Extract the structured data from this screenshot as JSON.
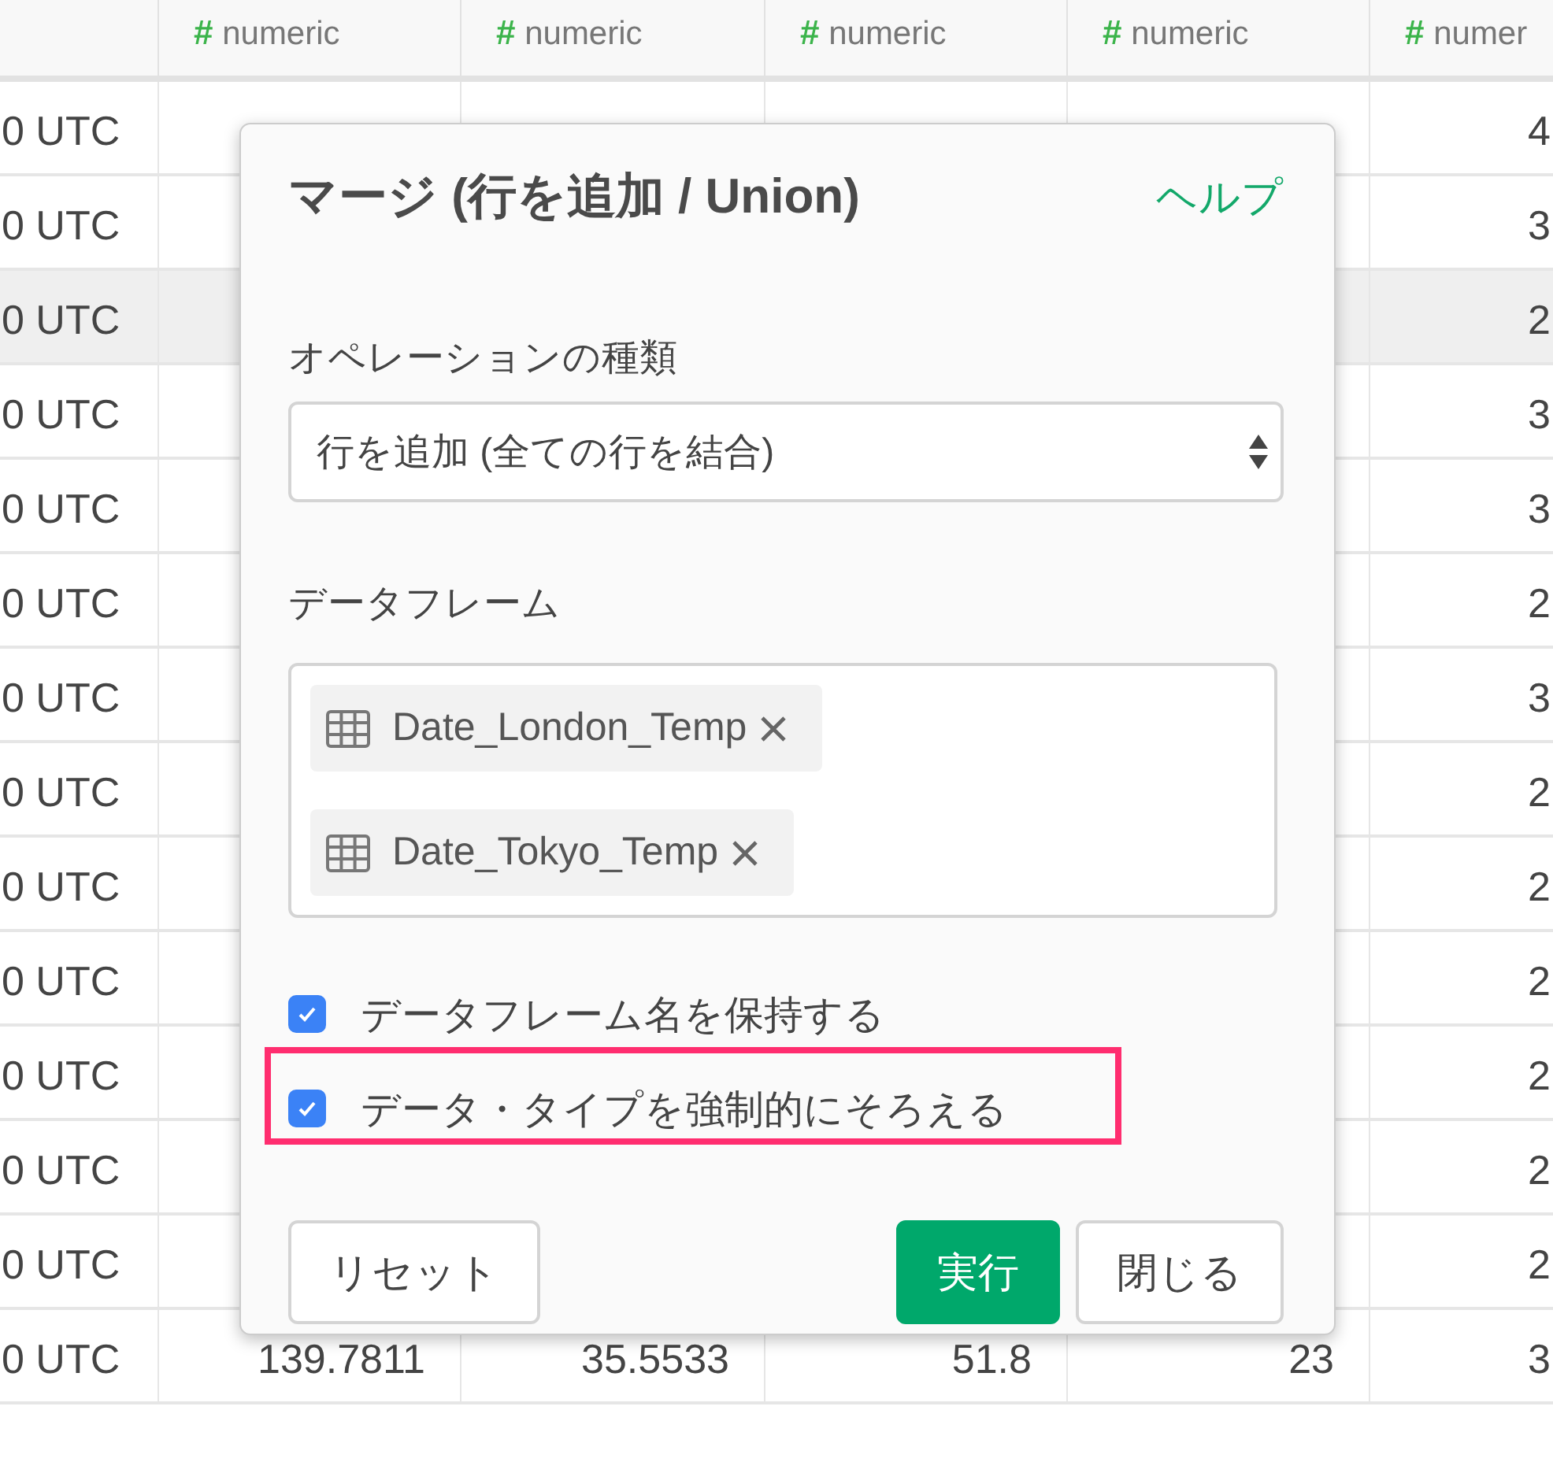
{
  "table": {
    "columns": [
      {
        "type_icon": "#",
        "label": "numeric"
      },
      {
        "type_icon": "#",
        "label": "numeric"
      },
      {
        "type_icon": "#",
        "label": "numeric"
      },
      {
        "type_icon": "#",
        "label": "numeric"
      },
      {
        "type_icon": "#",
        "label": "numer"
      }
    ],
    "rows": [
      {
        "highlighted": false,
        "cells": [
          "0 UTC",
          null,
          null,
          null,
          null,
          "4"
        ]
      },
      {
        "highlighted": false,
        "cells": [
          "0 UTC",
          null,
          null,
          null,
          null,
          "3"
        ]
      },
      {
        "highlighted": true,
        "cells": [
          "0 UTC",
          null,
          null,
          null,
          null,
          "2"
        ]
      },
      {
        "highlighted": false,
        "cells": [
          "0 UTC",
          null,
          null,
          null,
          null,
          "3"
        ]
      },
      {
        "highlighted": false,
        "cells": [
          "0 UTC",
          null,
          null,
          null,
          null,
          "3"
        ]
      },
      {
        "highlighted": false,
        "cells": [
          "0 UTC",
          null,
          null,
          null,
          null,
          "2"
        ]
      },
      {
        "highlighted": false,
        "cells": [
          "0 UTC",
          null,
          null,
          null,
          null,
          "3"
        ]
      },
      {
        "highlighted": false,
        "cells": [
          "0 UTC",
          null,
          null,
          null,
          null,
          "2"
        ]
      },
      {
        "highlighted": false,
        "cells": [
          "0 UTC",
          null,
          null,
          null,
          null,
          "2"
        ]
      },
      {
        "highlighted": false,
        "cells": [
          "0 UTC",
          null,
          null,
          null,
          null,
          "2"
        ]
      },
      {
        "highlighted": false,
        "cells": [
          "0 UTC",
          null,
          null,
          null,
          null,
          "2"
        ]
      },
      {
        "highlighted": false,
        "cells": [
          "0 UTC",
          null,
          null,
          null,
          null,
          "2"
        ]
      },
      {
        "highlighted": false,
        "cells": [
          "0 UTC",
          null,
          null,
          null,
          null,
          "2"
        ]
      },
      {
        "highlighted": false,
        "cells": [
          "0 UTC",
          "139.7811",
          "35.5533",
          "51.8",
          "23",
          "3"
        ]
      }
    ]
  },
  "dialog": {
    "title": "マージ (行を追加 / Union)",
    "help_link": "ヘルプ",
    "operation": {
      "label": "オペレーションの種類",
      "value": "行を追加 (全ての行を結合)"
    },
    "dataframes": {
      "label": "データフレーム",
      "items": [
        {
          "name": "Date_London_Temp"
        },
        {
          "name": "Date_Tokyo_Temp"
        }
      ]
    },
    "options": [
      {
        "label": "データフレーム名を保持する",
        "checked": true,
        "highlighted": false
      },
      {
        "label": "データ・タイプを強制的にそろえる",
        "checked": true,
        "highlighted": true
      }
    ],
    "buttons": [
      {
        "label": "リセット",
        "kind": "default"
      },
      {
        "label": "実行",
        "kind": "primary"
      },
      {
        "label": "閉じる",
        "kind": "default"
      }
    ]
  }
}
